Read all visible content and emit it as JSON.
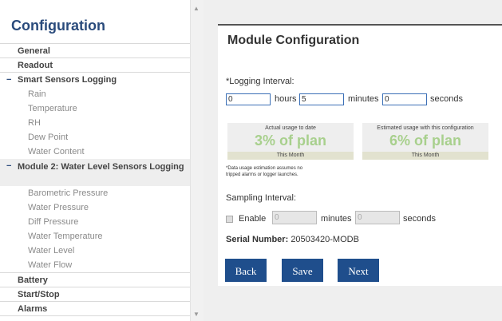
{
  "sidebar": {
    "title": "Configuration",
    "top_items": [
      "General",
      "Readout"
    ],
    "smart_sensors": {
      "label": "Smart Sensors Logging",
      "items": [
        "Rain",
        "Temperature",
        "RH",
        "Dew Point",
        "Water Content"
      ]
    },
    "module2": {
      "label": "Module 2: Water Level Sensors Logging",
      "items": [
        "Barometric Pressure",
        "Water Pressure",
        "Diff Pressure",
        "Water Temperature",
        "Water Level",
        "Water Flow"
      ]
    },
    "bottom_items": [
      "Battery",
      "Start/Stop",
      "Alarms"
    ]
  },
  "panel": {
    "title": "Module Configuration",
    "logging": {
      "label": "*Logging Interval:",
      "hours_value": "0",
      "hours_label": "hours",
      "minutes_value": "5",
      "minutes_label": "minutes",
      "seconds_value": "0",
      "seconds_label": "seconds"
    },
    "usage_actual": {
      "caption": "Actual usage to date",
      "value": "3% of plan",
      "footer": "This Month"
    },
    "usage_estimated": {
      "caption": "Estimated usage with this configuration",
      "value": "6% of plan",
      "footer": "This Month"
    },
    "note_line1": "*Data usage estimation assumes no",
    "note_line2": "tripped alarms or logger launches.",
    "sampling": {
      "label": "Sampling Interval:",
      "enable_label": "Enable",
      "minutes_value": "0",
      "minutes_label": "minutes",
      "seconds_value": "0",
      "seconds_label": "seconds"
    },
    "serial": {
      "label": "Serial Number:",
      "value": "20503420-MODB"
    },
    "buttons": {
      "back": "Back",
      "save": "Save",
      "next": "Next"
    }
  },
  "colors": {
    "accent": "#1f4e8c",
    "title": "#2a4b7c",
    "usage_value": "#a8d08d"
  }
}
